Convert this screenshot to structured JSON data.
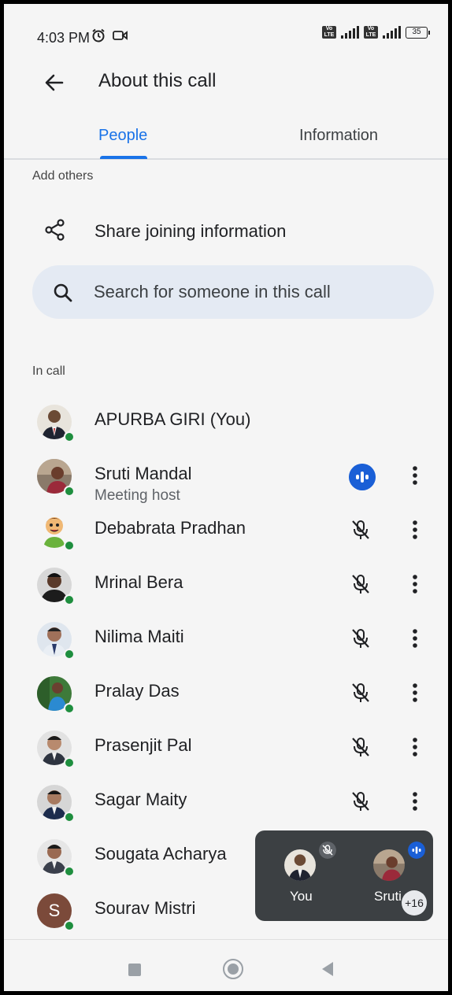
{
  "status_bar": {
    "time": "4:03 PM",
    "battery": "35",
    "network": "4G"
  },
  "header": {
    "title": "About this call"
  },
  "tabs": [
    {
      "label": "People",
      "active": true
    },
    {
      "label": "Information",
      "active": false
    }
  ],
  "add_others": {
    "label": "Add others",
    "share_label": "Share joining information"
  },
  "search": {
    "placeholder": "Search for someone in this call"
  },
  "in_call": {
    "label": "In call",
    "participants": [
      {
        "name": "APURBA GIRI (You)",
        "sub": "",
        "mic": "none",
        "avatar": "photo"
      },
      {
        "name": "Sruti Mandal",
        "sub": "Meeting host",
        "mic": "speaking",
        "avatar": "photo"
      },
      {
        "name": "Debabrata Pradhan",
        "sub": "",
        "mic": "muted",
        "avatar": "cartoon"
      },
      {
        "name": "Mrinal Bera",
        "sub": "",
        "mic": "muted",
        "avatar": "photo"
      },
      {
        "name": "Nilima Maiti",
        "sub": "",
        "mic": "muted",
        "avatar": "photo"
      },
      {
        "name": "Pralay Das",
        "sub": "",
        "mic": "muted",
        "avatar": "photo"
      },
      {
        "name": "Prasenjit Pal",
        "sub": "",
        "mic": "muted",
        "avatar": "photo"
      },
      {
        "name": "Sagar Maity",
        "sub": "",
        "mic": "muted",
        "avatar": "photo"
      },
      {
        "name": "Sougata Acharya",
        "sub": "",
        "mic": "none",
        "avatar": "photo"
      },
      {
        "name": "Sourav Mistri",
        "sub": "",
        "mic": "none",
        "avatar": "letter",
        "initial": "S"
      }
    ]
  },
  "preview": {
    "you_label": "You",
    "other_label": "Sruti",
    "more_count": "+16"
  },
  "colors": {
    "accent": "#1a73e8",
    "online": "#1e8e3e",
    "speaking": "#1a5fd6",
    "avatar_letter_bg": "#7b4a3a"
  }
}
